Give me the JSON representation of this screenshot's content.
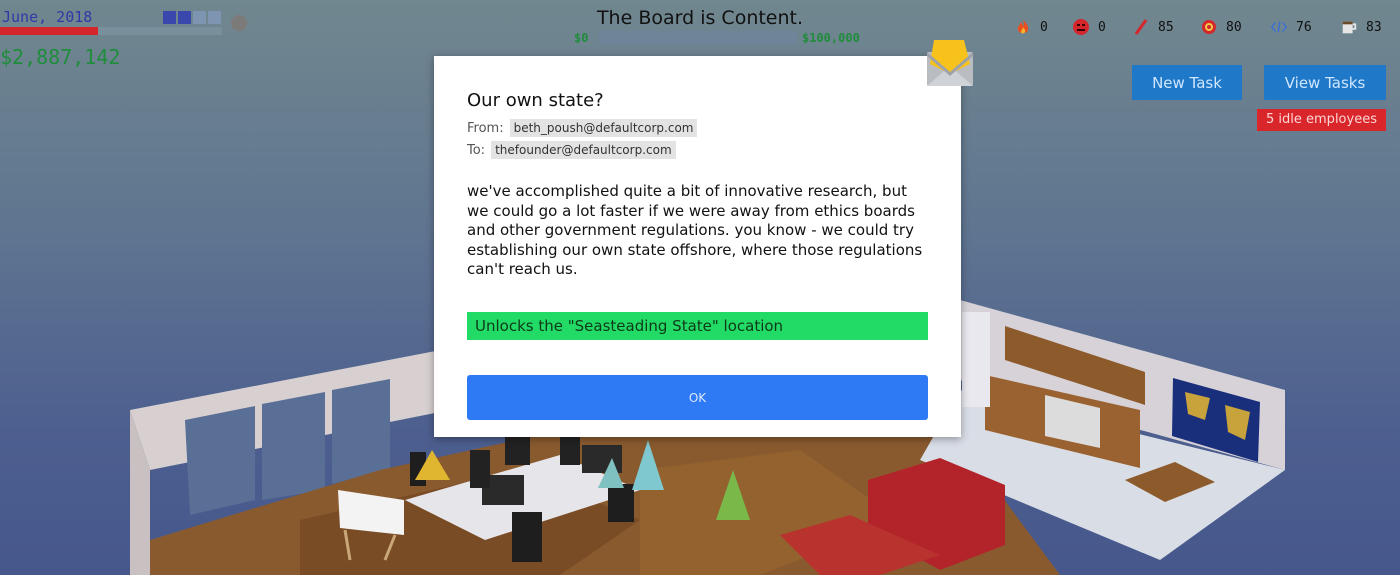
{
  "hud": {
    "date": "June, 2018",
    "cash": "$2,887,142",
    "month_progress": 0.44,
    "week_squares_on": 2,
    "week_squares_total": 4
  },
  "board": {
    "status": "The Board is Content.",
    "min_label": "$0",
    "max_label": "$100,000",
    "progress": 0.0
  },
  "stats": [
    {
      "icon": "fire-icon",
      "value": "0",
      "color": "#e8501f"
    },
    {
      "icon": "angry-face-icon",
      "value": "0",
      "color": "#d4262b"
    },
    {
      "icon": "pencil-icon",
      "value": "85",
      "color": "#d4262b"
    },
    {
      "icon": "target-icon",
      "value": "80",
      "color": "#d4262b"
    },
    {
      "icon": "code-icon",
      "value": "76",
      "color": "#3a6fd8"
    },
    {
      "icon": "coffee-mug-icon",
      "value": "83",
      "color": "#cccccc"
    }
  ],
  "actions": {
    "new_task": "New Task",
    "view_tasks": "View Tasks",
    "idle_badge": "5 idle employees"
  },
  "email": {
    "subject": "Our own state?",
    "from_label": "From:",
    "from": "beth_poush@defaultcorp.com",
    "to_label": "To:",
    "to": "thefounder@defaultcorp.com",
    "body": "we've accomplished quite a bit of innovative research, but we could go a lot faster if we were away from ethics boards and other government regulations. you know - we could try establishing our own state offshore, where those regulations can't reach us.",
    "effect": "Unlocks the \"Seasteading State\" location",
    "ok_label": "OK"
  },
  "colors": {
    "accent": "#2e7af5",
    "cash": "#1f8d3c",
    "alert": "#d8262b",
    "effect": "#22db66"
  }
}
